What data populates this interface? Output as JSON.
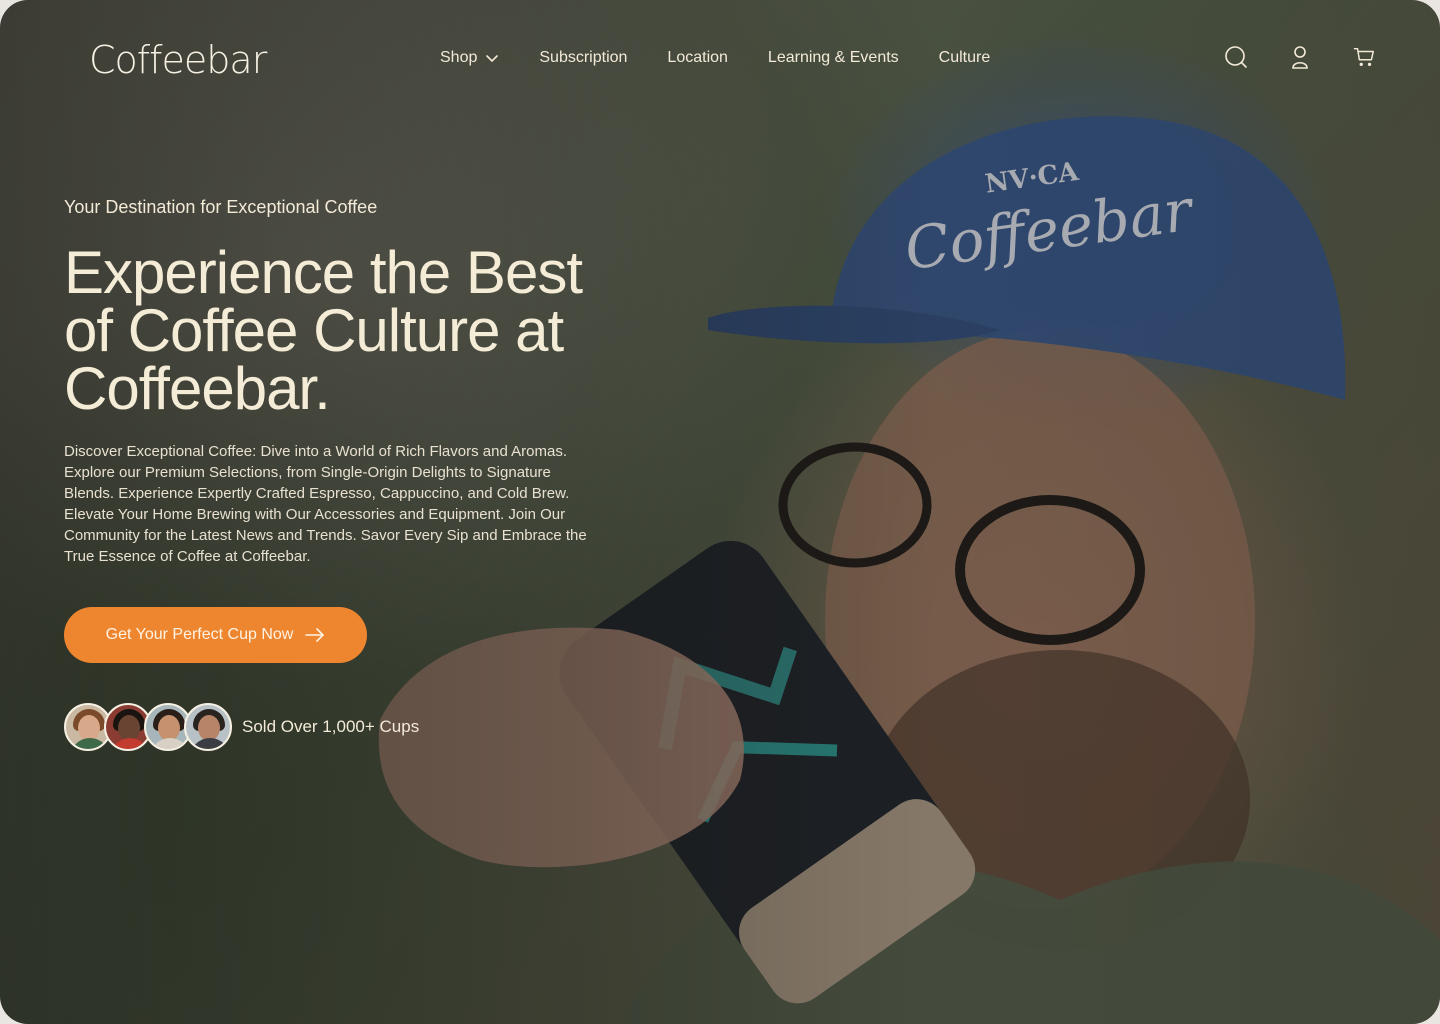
{
  "brand": {
    "logo_text": "Coffeebar"
  },
  "nav": {
    "items": [
      {
        "label": "Shop",
        "has_dropdown": true
      },
      {
        "label": "Subscription"
      },
      {
        "label": "Location"
      },
      {
        "label": "Learning & Events"
      },
      {
        "label": "Culture"
      }
    ]
  },
  "header_icons": [
    "search-icon",
    "user-icon",
    "cart-icon"
  ],
  "hero": {
    "eyebrow": "Your Destination for Exceptional Coffee",
    "headline": "Experience the Best of Coffee Culture at Coffeebar.",
    "description": "Discover Exceptional Coffee: Dive into a World of Rich Flavors and Aromas. Explore our Premium Selections, from Single-Origin Delights to Signature Blends. Experience Expertly Crafted Espresso, Cappuccino, and Cold Brew. Elevate Your Home Brewing with Our Accessories and Equipment. Join Our Community for the Latest News and Trends. Savor Every Sip and Embrace the True Essence of Coffee at Coffeebar.",
    "cta_label": "Get Your Perfect Cup Now",
    "social_proof": "Sold Over 1,000+ Cups",
    "cap_text_top": "NV·CA",
    "cap_text_logo": "Coffeebar"
  },
  "colors": {
    "accent": "#EE8630",
    "text_cream": "#F4ECD6",
    "cap_blue": "#3C5482"
  }
}
